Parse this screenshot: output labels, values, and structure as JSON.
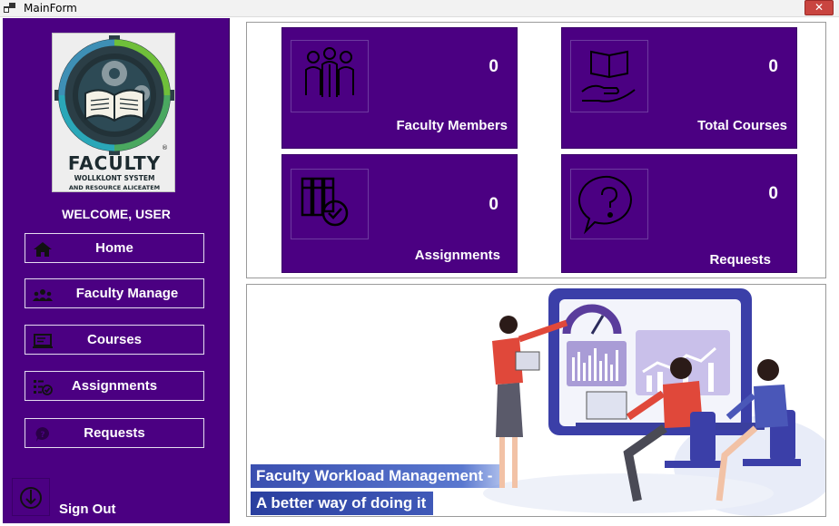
{
  "window": {
    "title": "MainForm",
    "close_glyph": "✕"
  },
  "sidebar": {
    "logo": {
      "title": "FACULTY",
      "subtitle1": "WOLLKLONT SYSTEM",
      "subtitle2": "AND RESOURCE ALICEATEM",
      "registered": "®"
    },
    "welcome": "WELCOME, USER",
    "items": [
      {
        "label": "Home",
        "icon": "home-icon"
      },
      {
        "label": "Faculty Manage",
        "icon": "people-icon"
      },
      {
        "label": "Courses",
        "icon": "screen-icon"
      },
      {
        "label": "Assignments",
        "icon": "checklist-icon"
      },
      {
        "label": "Requests",
        "icon": "question-bubble-icon"
      }
    ],
    "signout": {
      "label": "Sign Out",
      "icon": "power-icon"
    }
  },
  "stats": [
    {
      "label": "Faculty Members",
      "value": "0",
      "icon": "faculty-group-icon"
    },
    {
      "label": "Total Courses",
      "value": "0",
      "icon": "book-hand-icon"
    },
    {
      "label": "Assignments",
      "value": "0",
      "icon": "binders-check-icon"
    },
    {
      "label": "Requests",
      "value": "0",
      "icon": "question-bubble-icon"
    }
  ],
  "banner": {
    "line1": "Faculty Workload Management -",
    "line2": "A better way of doing it"
  },
  "colors": {
    "sidebar": "#4b0082",
    "card": "#4b0082",
    "close": "#c94540"
  }
}
